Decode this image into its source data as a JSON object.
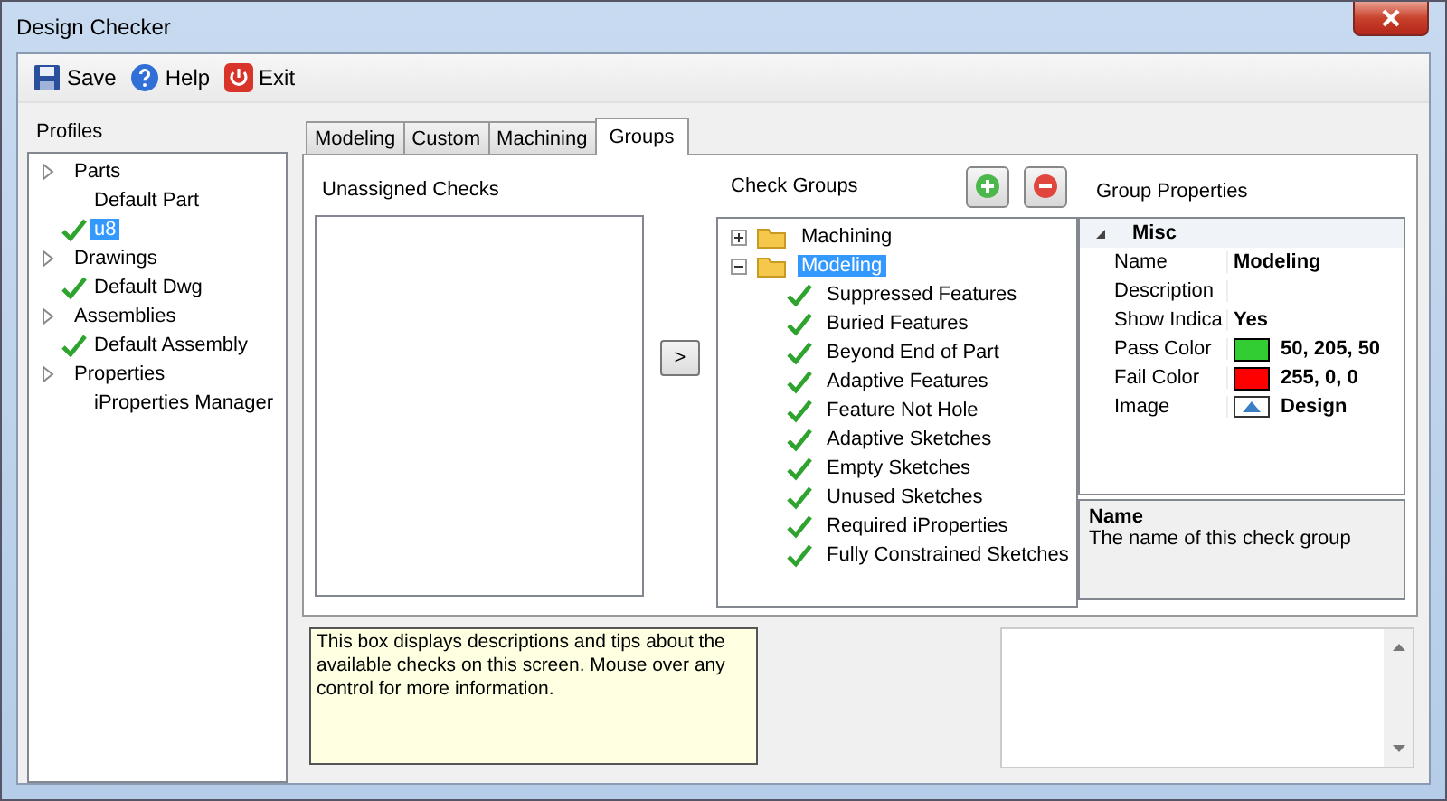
{
  "window": {
    "title": "Design Checker"
  },
  "toolbar": [
    {
      "label": "Save",
      "kind": "save"
    },
    {
      "label": "Help",
      "kind": "help"
    },
    {
      "label": "Exit",
      "kind": "exit"
    }
  ],
  "profiles": {
    "label": "Profiles",
    "items": [
      {
        "label": "Parts",
        "children": [
          {
            "label": "Default Part",
            "checked": false,
            "selected": false
          },
          {
            "label": "u8",
            "checked": true,
            "selected": true
          }
        ]
      },
      {
        "label": "Drawings",
        "children": [
          {
            "label": "Default Dwg",
            "checked": true,
            "selected": false
          }
        ]
      },
      {
        "label": "Assemblies",
        "children": [
          {
            "label": "Default Assembly",
            "checked": true,
            "selected": false
          }
        ]
      },
      {
        "label": "Properties",
        "children": [
          {
            "label": "iProperties Manager",
            "checked": false,
            "selected": false
          }
        ]
      }
    ]
  },
  "tabs": [
    {
      "label": "Modeling",
      "selected": false
    },
    {
      "label": "Custom",
      "selected": false
    },
    {
      "label": "Machining",
      "selected": false
    },
    {
      "label": "Groups",
      "selected": true
    }
  ],
  "unassigned": {
    "label": "Unassigned Checks",
    "move_button": ">"
  },
  "check_groups": {
    "label": "Check Groups",
    "groups": [
      {
        "label": "Machining",
        "expanded": false,
        "selected": false
      },
      {
        "label": "Modeling",
        "expanded": true,
        "selected": true,
        "children": [
          {
            "label": "Suppressed Features",
            "checked": true
          },
          {
            "label": "Buried Features",
            "checked": true
          },
          {
            "label": "Beyond End of Part",
            "checked": true
          },
          {
            "label": "Adaptive Features",
            "checked": true
          },
          {
            "label": "Feature Not Hole",
            "checked": true
          },
          {
            "label": "Adaptive Sketches",
            "checked": true
          },
          {
            "label": "Empty Sketches",
            "checked": true
          },
          {
            "label": "Unused Sketches",
            "checked": true
          },
          {
            "label": "Required iProperties",
            "checked": true
          },
          {
            "label": "Fully Constrained Sketches",
            "checked": true
          }
        ]
      }
    ]
  },
  "group_properties": {
    "label": "Group Properties",
    "category": "Misc",
    "rows": [
      {
        "name": "Name",
        "value": "Modeling",
        "kind": "text"
      },
      {
        "name": "Description",
        "kind": "text"
      },
      {
        "name": "Show Indica",
        "value": "Yes",
        "kind": "text"
      },
      {
        "name": "Pass Color",
        "value": "50, 205, 50",
        "kind": "color",
        "color": "#32cd32"
      },
      {
        "name": "Fail Color",
        "value": "255, 0, 0",
        "kind": "color",
        "color": "#ff0000"
      },
      {
        "name": "Image",
        "value": "Design",
        "kind": "image"
      }
    ],
    "help_title": "Name",
    "help_text": "The name of this check group"
  },
  "tips": "This box displays descriptions and tips about the available checks on this screen. Mouse over any control for more information."
}
